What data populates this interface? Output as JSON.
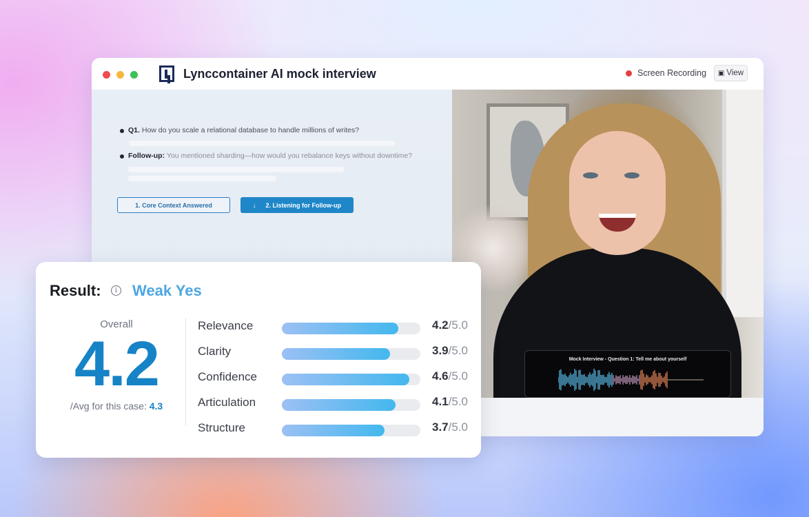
{
  "window": {
    "title": "Lynccontainer AI mock interview",
    "recording_label": "Screen Recording",
    "view_button_label": "View",
    "view_icon": "clapperboard-icon",
    "traffic_lights": {
      "red": "#f04c4c",
      "yellow": "#f6b73c",
      "green": "#3dc25a"
    }
  },
  "questions": {
    "q1_prefix": "Q1.",
    "q1_text": "How do you scale a relational database to handle millions of writes?",
    "followup_prefix": "Follow-up:",
    "followup_text": "You mentioned sharding—how would you rebalance keys without downtime?",
    "steps": [
      {
        "label": "1. Core Context Answered",
        "state": "done"
      },
      {
        "label": "2. Listening for Follow-up",
        "state": "active",
        "icon": "↓"
      }
    ]
  },
  "video": {
    "caption": "Mock Interview - Question 1: Tell me about yourself"
  },
  "result": {
    "label": "Result:",
    "verdict": "Weak Yes",
    "overall_label": "Overall",
    "overall_value": "4.2",
    "avg_label": "/Avg for this case:",
    "avg_value": "4.3",
    "metrics": [
      {
        "name": "Relevance",
        "score": "4.2",
        "max": "/5.0",
        "value": 4.2
      },
      {
        "name": "Clarity",
        "score": "3.9",
        "max": "/5.0",
        "value": 3.9
      },
      {
        "name": "Confidence",
        "score": "4.6",
        "max": "/5.0",
        "value": 4.6
      },
      {
        "name": "Articulation",
        "score": "4.1",
        "max": "/5.0",
        "value": 4.1
      },
      {
        "name": "Structure",
        "score": "3.7",
        "max": "/5.0",
        "value": 3.7
      }
    ],
    "colors": {
      "accent": "#1683c6",
      "verdict": "#4da6e2"
    }
  }
}
